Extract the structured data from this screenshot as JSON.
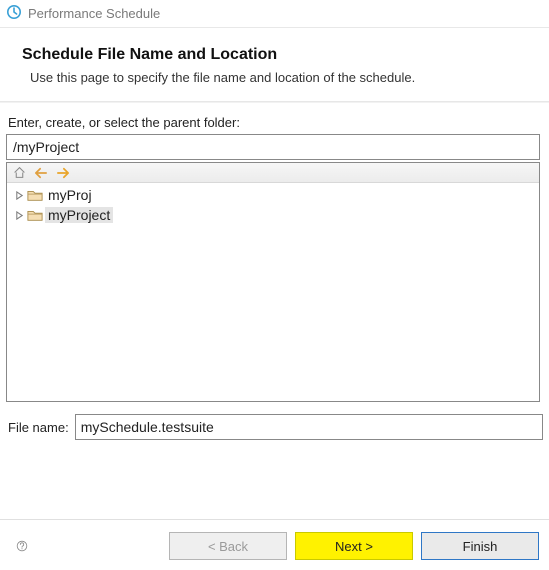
{
  "window": {
    "title": "Performance Schedule"
  },
  "header": {
    "heading": "Schedule File Name and Location",
    "description": "Use this page to specify the file name and location of the schedule."
  },
  "parentFolder": {
    "label": "Enter, create, or select the parent folder:",
    "value": "/myProject"
  },
  "tree": {
    "items": [
      {
        "label": "myProj",
        "selected": false
      },
      {
        "label": "myProject",
        "selected": true
      }
    ]
  },
  "filename": {
    "label": "File name:",
    "value": "mySchedule.testsuite",
    "highlighted_part": "mySchedule",
    "rest_part": ".testsuite"
  },
  "buttons": {
    "back": "< Back",
    "next": "Next >",
    "finish": "Finish"
  }
}
